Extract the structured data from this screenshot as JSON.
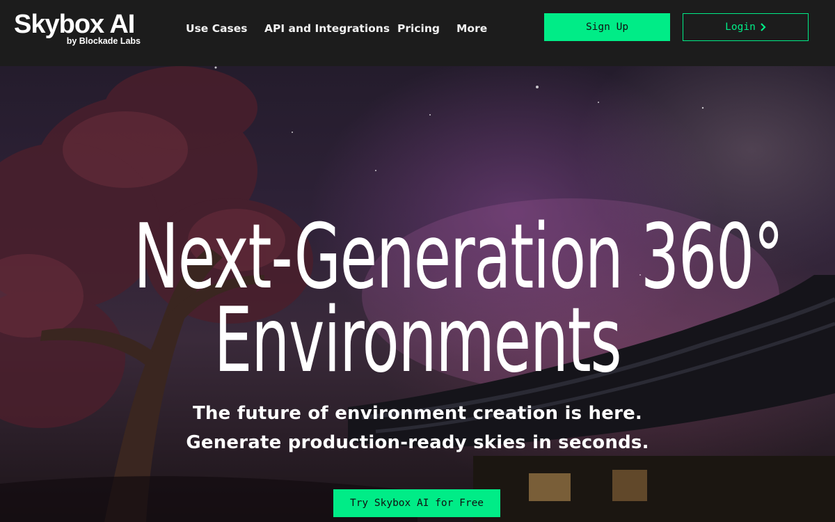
{
  "logo": {
    "title": "Skybox AI",
    "subtitle": "by Blockade Labs"
  },
  "nav": {
    "items": [
      {
        "label": "Use Cases"
      },
      {
        "label": "API and Integrations"
      },
      {
        "label": "Pricing"
      },
      {
        "label": "More"
      }
    ],
    "signup_label": "Sign Up",
    "login_label": "Login"
  },
  "hero": {
    "headline_line1": "Next-Generation 360°",
    "headline_line2": "Environments",
    "subtitle_line1": "The future of environment creation is here.",
    "subtitle_line2": "Generate production-ready skies in seconds.",
    "cta_label": "Try Skybox AI for Free"
  },
  "icons": {
    "login_chevron": "chevron-right-icon"
  },
  "colors": {
    "accent": "#00ec87",
    "navbar_bg": "#1c1c1c",
    "text": "#ffffff"
  }
}
